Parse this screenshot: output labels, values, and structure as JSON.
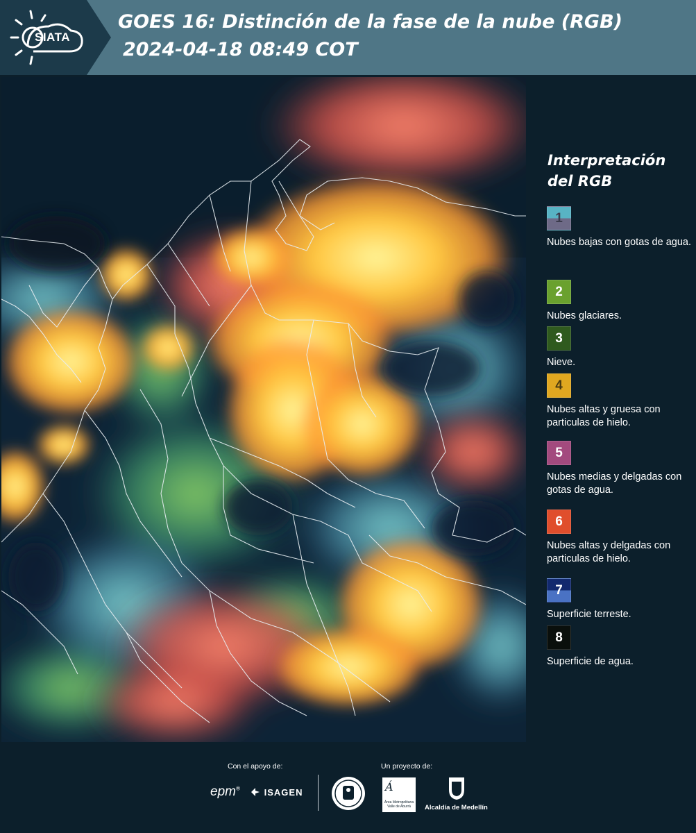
{
  "header": {
    "logo_text": "SIATA",
    "title_line1": "GOES 16: Distinción de la fase de la nube (RGB)",
    "title_line2": "2024-04-18 08:49 COT"
  },
  "legend": {
    "title_line1": "Interpretación",
    "title_line2": "del RGB",
    "items": [
      {
        "num": "1",
        "top_color": "#58b3c4",
        "bottom_color": "#6e6a87",
        "num_color": "#3b3b4c",
        "desc": "Nubes bajas con gotas de agua."
      },
      {
        "num": "2",
        "top_color": "#6aa12e",
        "bottom_color": "#6aa12e",
        "num_color": "#ffffff",
        "desc": "Nubes glaciares."
      },
      {
        "num": "3",
        "top_color": "#2f5a1e",
        "bottom_color": "#2f5a1e",
        "num_color": "#ffffff",
        "desc": "Nieve."
      },
      {
        "num": "4",
        "top_color": "#e0a720",
        "bottom_color": "#e0a720",
        "num_color": "#4b3a10",
        "desc": "Nubes altas y gruesa con particulas de hielo."
      },
      {
        "num": "5",
        "top_color": "#a34a7e",
        "bottom_color": "#a34a7e",
        "num_color": "#ffffff",
        "desc": "Nubes medias y delgadas con gotas de agua."
      },
      {
        "num": "6",
        "top_color": "#e04e2c",
        "bottom_color": "#e04e2c",
        "num_color": "#ffffff",
        "desc": "Nubes altas y delgadas con particulas de hielo."
      },
      {
        "num": "7",
        "top_color": "#12296e",
        "bottom_color": "#4a72c4",
        "num_color": "#ffffff",
        "desc": "Superficie terreste."
      },
      {
        "num": "8",
        "top_color": "#0a0f0c",
        "bottom_color": "#0a0f0c",
        "num_color": "#ffffff",
        "desc": "Superficie de agua."
      }
    ]
  },
  "footer": {
    "support_label": "Con el apoyo de:",
    "project_label": "Un proyecto de:",
    "sponsor1": "epm",
    "sponsor2": "ISAGEN",
    "partner1": "Área Metropolitana",
    "partner1_sub": "Valle de Aburrá",
    "partner2": "Alcaldía de Medellín"
  },
  "icons": {
    "logo": "sun-cloud-icon",
    "seal": "university-seal-icon",
    "shield": "coat-of-arms-icon"
  }
}
